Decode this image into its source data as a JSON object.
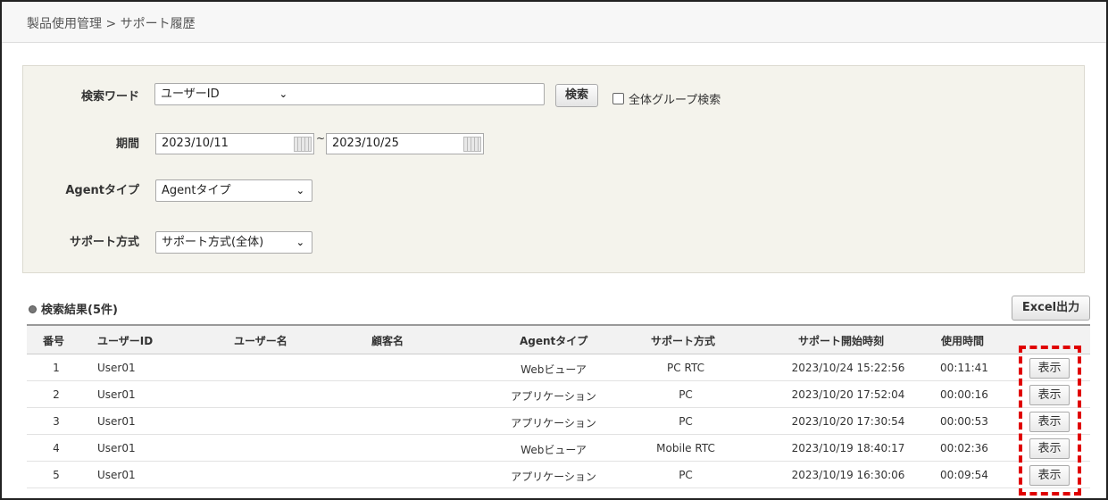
{
  "breadcrumb": "製品使用管理 > サポート履歴",
  "search": {
    "keyword_label": "検索ワード",
    "keyword_type": "ユーザーID",
    "search_button": "検索",
    "all_group_label": "全体グループ検索",
    "period_label": "期間",
    "date_from": "2023/10/11",
    "date_sep": "~",
    "date_to": "2023/10/25",
    "agent_type_label": "Agentタイプ",
    "agent_type_value": "Agentタイプ",
    "support_method_label": "サポート方式",
    "support_method_value": "サポート方式(全体)"
  },
  "results": {
    "title": "検索結果(5件)",
    "excel_button": "Excel出力",
    "headers": [
      "番号",
      "ユーザーID",
      "ユーザー名",
      "顧客名",
      "Agentタイプ",
      "サポート方式",
      "サポート開始時刻",
      "使用時間"
    ],
    "view_label": "表示",
    "rows": [
      {
        "no": "1",
        "user_id": "User01",
        "user_name": "",
        "customer": "",
        "agent_type": "Webビューア",
        "method": "PC RTC",
        "start": "2023/10/24 15:22:56",
        "duration": "00:11:41"
      },
      {
        "no": "2",
        "user_id": "User01",
        "user_name": "",
        "customer": "",
        "agent_type": "アプリケーション",
        "method": "PC",
        "start": "2023/10/20 17:52:04",
        "duration": "00:00:16"
      },
      {
        "no": "3",
        "user_id": "User01",
        "user_name": "",
        "customer": "",
        "agent_type": "アプリケーション",
        "method": "PC",
        "start": "2023/10/20 17:30:54",
        "duration": "00:00:53"
      },
      {
        "no": "4",
        "user_id": "User01",
        "user_name": "",
        "customer": "",
        "agent_type": "Webビューア",
        "method": "Mobile RTC",
        "start": "2023/10/19 18:40:17",
        "duration": "00:02:36"
      },
      {
        "no": "5",
        "user_id": "User01",
        "user_name": "",
        "customer": "",
        "agent_type": "アプリケーション",
        "method": "PC",
        "start": "2023/10/19 16:30:06",
        "duration": "00:09:54"
      }
    ]
  },
  "colors": {
    "highlight": "#e00000",
    "panel": "#f4f3ec"
  }
}
